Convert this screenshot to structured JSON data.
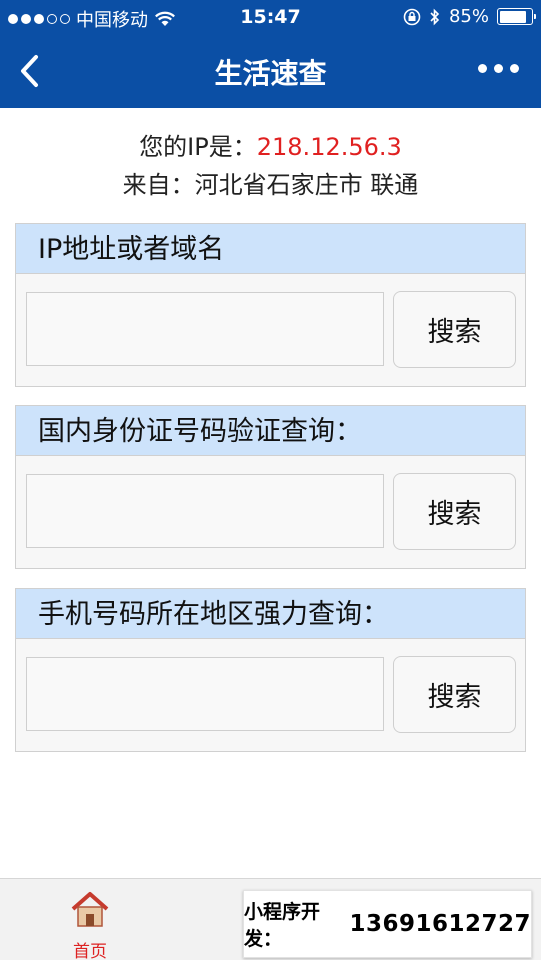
{
  "status_bar": {
    "carrier": "中国移动",
    "time": "15:47",
    "battery_percent": "85%",
    "battery_level": 0.85
  },
  "nav": {
    "title": "生活速查",
    "back_icon": "chevron-left-icon",
    "more_icon": "more-dots-icon"
  },
  "ip_info": {
    "ip_label": "您的IP是：",
    "ip_value": "218.12.56.3",
    "from_label": "来自：",
    "location": "河北省石家庄市 联通"
  },
  "panels": [
    {
      "title": "IP地址或者域名",
      "input_value": "",
      "button_label": "搜索"
    },
    {
      "title": "国内身份证号码验证查询：",
      "input_value": "",
      "button_label": "搜索"
    },
    {
      "title": "手机号码所在地区强力查询：",
      "input_value": "",
      "button_label": "搜索"
    }
  ],
  "tabs": [
    {
      "label": "首页",
      "icon": "home-icon",
      "active": true
    },
    {
      "label": "",
      "icon": "tab-2-icon",
      "active": false
    },
    {
      "label": "",
      "icon": "tab-3-icon",
      "active": false
    }
  ],
  "promo": {
    "label": "小程序开发：",
    "phone": "13691612727"
  },
  "colors": {
    "header_blue": "#0b4fa5",
    "panel_head_bg": "#cde3fb",
    "ip_red": "#e02020",
    "active_tab_red": "#d22222"
  }
}
